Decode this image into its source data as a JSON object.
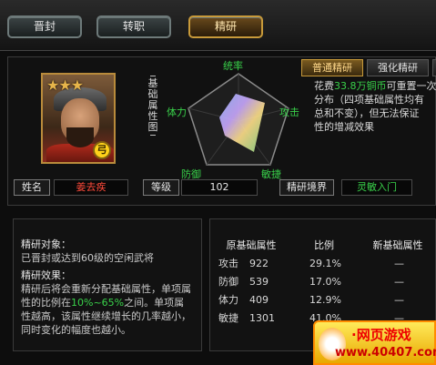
{
  "top_tabs": [
    {
      "label": "晋封",
      "active": false
    },
    {
      "label": "转职",
      "active": false
    },
    {
      "label": "精研",
      "active": true
    }
  ],
  "hero": {
    "stars": "★★★",
    "badge": "弓",
    "name_label": "姓名",
    "name_value": "姜去疾",
    "level_label": "等级",
    "level_value": "102",
    "realm_label": "精研境界",
    "realm_value": "灵敏入门"
  },
  "radar": {
    "title": "基础属性图",
    "axes": {
      "top": "统率",
      "right": "攻击",
      "bottom_right": "敏捷",
      "bottom_left": "防御",
      "left": "体力"
    }
  },
  "right_tabs": [
    {
      "label": "普通精研",
      "active": true
    },
    {
      "label": "强化精研",
      "active": false
    }
  ],
  "description": {
    "p1": "花费",
    "cost": "33.8万铜币",
    "p2": "可重置一次",
    "p3": "分布（四项基础属性均有",
    "p4": "总和不变），但无法保证",
    "p5": "性的增减效果"
  },
  "info": {
    "target_head": "精研对象：",
    "target_text": "已晋封或达到60级的空闲武将",
    "effect_head": "精研效果：",
    "effect_text_1": "精研后将会重新分配基础属性，单项属性的比例在",
    "effect_range": "10%~65%",
    "effect_text_2": "之间。单项属性越高，该属性继续增长的几率越小，同时变化的幅度也越小。"
  },
  "stats_table": {
    "headers": [
      "原基础属性",
      "比例",
      "新基础属性"
    ],
    "rows": [
      {
        "name": "攻击",
        "value": "922",
        "ratio": "29.1%",
        "new": "—"
      },
      {
        "name": "防御",
        "value": "539",
        "ratio": "17.0%",
        "new": "—"
      },
      {
        "name": "体力",
        "value": "409",
        "ratio": "12.9%",
        "new": "—"
      },
      {
        "name": "敏捷",
        "value": "1301",
        "ratio": "41.0%",
        "new": "—"
      }
    ]
  },
  "watermark": {
    "line1": "·网页游戏",
    "line2": "www.40407.com"
  }
}
